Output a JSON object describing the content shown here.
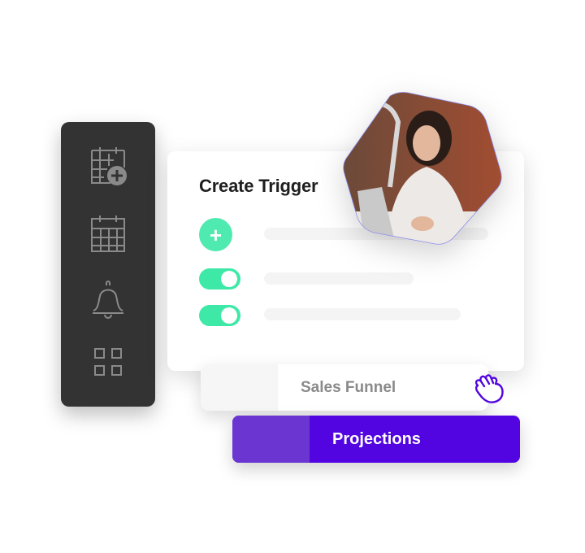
{
  "sidebar": {
    "items": [
      {
        "icon": "calendar-add-icon"
      },
      {
        "icon": "calendar-icon"
      },
      {
        "icon": "bell-icon"
      },
      {
        "icon": "grid-icon"
      }
    ]
  },
  "card": {
    "title": "Create Trigger",
    "add_button": {
      "icon": "plus-icon",
      "glyph": "+"
    },
    "toggles": [
      {
        "state": "on"
      },
      {
        "state": "on"
      }
    ]
  },
  "photo": {
    "description": "woman working at laptop",
    "shape": "hexagon"
  },
  "options": [
    {
      "label": "Sales Funnel",
      "selected": false
    },
    {
      "label": "Projections",
      "selected": true
    }
  ],
  "cursor": {
    "icon": "grab-hand-icon"
  },
  "colors": {
    "sidebar_bg": "#333333",
    "accent_green": "#3ee9a8",
    "accent_purple": "#5205e0",
    "purple_light": "#6a35d0"
  }
}
